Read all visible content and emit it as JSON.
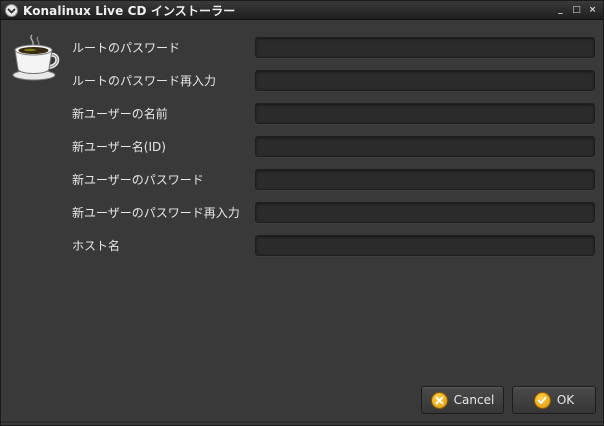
{
  "window": {
    "title": "Konalinux Live CD インストーラー",
    "controls": {
      "minimize": "_",
      "maximize": "□",
      "close": "×"
    }
  },
  "form": {
    "fields": [
      {
        "label": "ルートのパスワード",
        "value": ""
      },
      {
        "label": "ルートのパスワード再入力",
        "value": ""
      },
      {
        "label": "新ユーザーの名前",
        "value": ""
      },
      {
        "label": "新ユーザー名(ID)",
        "value": ""
      },
      {
        "label": "新ユーザーのパスワード",
        "value": ""
      },
      {
        "label": "新ユーザーのパスワード再入力",
        "value": ""
      },
      {
        "label": "ホスト名",
        "value": ""
      }
    ]
  },
  "buttons": {
    "cancel_label": "Cancel",
    "ok_label": "OK"
  },
  "icons": {
    "app": "coffee-cup-icon",
    "cancel": "cancel-icon",
    "ok": "check-icon"
  },
  "colors": {
    "background": "#393939",
    "input_bg": "#2b2b2b",
    "text": "#e6e6e6",
    "button_icon": "#f0b020"
  }
}
